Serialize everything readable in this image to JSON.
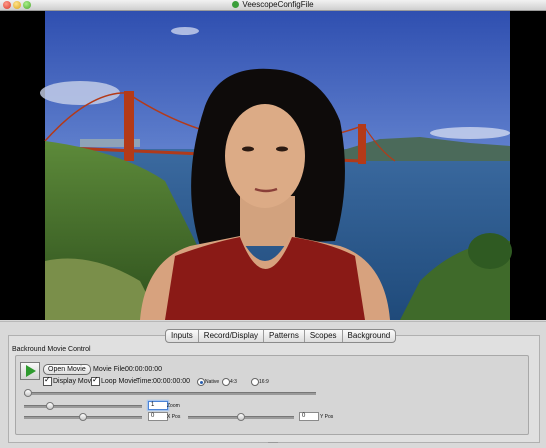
{
  "window": {
    "title": "VeescopeConfigFile"
  },
  "tabs": [
    "Inputs",
    "Record/Display",
    "Patterns",
    "Scopes",
    "Background"
  ],
  "panel": {
    "section_label": "Backround Movie Control",
    "open_movie_label": "Open Movie",
    "movie_file_label": "Movie File:",
    "movie_file_value": "00:00:00:00",
    "display_movie_label": "Display Movie",
    "display_movie_checked": true,
    "loop_movie_label": "Loop Movie",
    "loop_movie_checked": true,
    "time_label": "Time:",
    "time_value": "00:00:00:00",
    "aspect_options": [
      "Native",
      "4:3",
      "16:9"
    ],
    "aspect_selected": "Native",
    "zoom_value": "1",
    "zoom_label": "Zoom",
    "xpos_value": "0",
    "xpos_label": "X Pos",
    "ypos_value": "0",
    "ypos_label": "Y Pos",
    "position_slider": 0.0,
    "zoom_slider": 0.0,
    "xpos_slider": 0.5,
    "ypos_slider": 0.5
  }
}
